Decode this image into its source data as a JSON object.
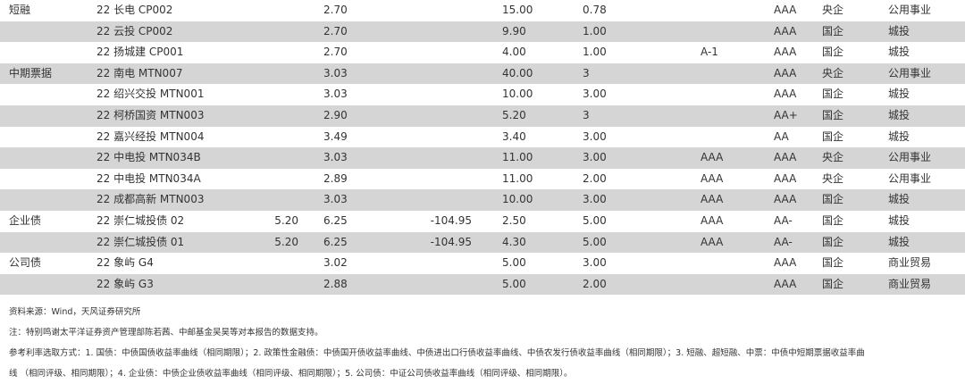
{
  "rows": [
    {
      "cat": "短融",
      "name": "22 长电 CP002",
      "c2": "",
      "c3": "2.70",
      "c4": "",
      "c5": "15.00",
      "c6": "0.78",
      "c7": "",
      "c8": "",
      "c9": "AAA",
      "c10": "央企",
      "c11": "公用事业",
      "shade": false
    },
    {
      "cat": "",
      "name": "22 云投 CP002",
      "c2": "",
      "c3": "2.70",
      "c4": "",
      "c5": "9.90",
      "c6": "1.00",
      "c7": "",
      "c8": "",
      "c9": "AAA",
      "c10": "国企",
      "c11": "城投",
      "shade": true
    },
    {
      "cat": "",
      "name": "22 扬城建 CP001",
      "c2": "",
      "c3": "2.70",
      "c4": "",
      "c5": "4.00",
      "c6": "1.00",
      "c7": "A-1",
      "c8": "",
      "c9": "AAA",
      "c10": "国企",
      "c11": "城投",
      "shade": false
    },
    {
      "cat": "中期票据",
      "name": "22 南电 MTN007",
      "c2": "",
      "c3": "3.03",
      "c4": "",
      "c5": "40.00",
      "c6": "3",
      "c7": "",
      "c8": "",
      "c9": "AAA",
      "c10": "央企",
      "c11": "公用事业",
      "shade": true
    },
    {
      "cat": "",
      "name": "22 绍兴交投 MTN001",
      "c2": "",
      "c3": "3.03",
      "c4": "",
      "c5": "10.00",
      "c6": "3.00",
      "c7": "",
      "c8": "",
      "c9": "AAA",
      "c10": "国企",
      "c11": "城投",
      "shade": false
    },
    {
      "cat": "",
      "name": "22 柯桥国资 MTN003",
      "c2": "",
      "c3": "2.90",
      "c4": "",
      "c5": "5.20",
      "c6": "3",
      "c7": "",
      "c8": "",
      "c9": "AA+",
      "c10": "国企",
      "c11": "城投",
      "shade": true
    },
    {
      "cat": "",
      "name": "22 嘉兴经投 MTN004",
      "c2": "",
      "c3": "3.49",
      "c4": "",
      "c5": "3.40",
      "c6": "3.00",
      "c7": "",
      "c8": "",
      "c9": "AA",
      "c10": "国企",
      "c11": "城投",
      "shade": false
    },
    {
      "cat": "",
      "name": "22 中电投 MTN034B",
      "c2": "",
      "c3": "3.03",
      "c4": "",
      "c5": "11.00",
      "c6": "3.00",
      "c7": "AAA",
      "c8": "",
      "c9": "AAA",
      "c10": "央企",
      "c11": "公用事业",
      "shade": true
    },
    {
      "cat": "",
      "name": "22 中电投 MTN034A",
      "c2": "",
      "c3": "2.89",
      "c4": "",
      "c5": "11.00",
      "c6": "2.00",
      "c7": "AAA",
      "c8": "",
      "c9": "AAA",
      "c10": "央企",
      "c11": "公用事业",
      "shade": false
    },
    {
      "cat": "",
      "name": "22 成都高新 MTN003",
      "c2": "",
      "c3": "3.03",
      "c4": "",
      "c5": "10.00",
      "c6": "3.00",
      "c7": "AAA",
      "c8": "",
      "c9": "AAA",
      "c10": "国企",
      "c11": "城投",
      "shade": true
    },
    {
      "cat": "企业债",
      "name": "22 崇仁城投债 02",
      "c2": "5.20",
      "c3": "6.25",
      "c4": "-104.95",
      "c5": "2.50",
      "c6": "5.00",
      "c7": "AAA",
      "c8": "",
      "c9": "AA-",
      "c10": "国企",
      "c11": "城投",
      "shade": false
    },
    {
      "cat": "",
      "name": "22 崇仁城投债 01",
      "c2": "5.20",
      "c3": "6.25",
      "c4": "-104.95",
      "c5": "4.30",
      "c6": "5.00",
      "c7": "AAA",
      "c8": "",
      "c9": "AA-",
      "c10": "国企",
      "c11": "城投",
      "shade": true
    },
    {
      "cat": "公司债",
      "name": "22 象屿 G4",
      "c2": "",
      "c3": "3.02",
      "c4": "",
      "c5": "5.00",
      "c6": "3.00",
      "c7": "",
      "c8": "",
      "c9": "AAA",
      "c10": "国企",
      "c11": "商业贸易",
      "shade": false
    },
    {
      "cat": "",
      "name": "22 象屿 G3",
      "c2": "",
      "c3": "2.88",
      "c4": "",
      "c5": "5.00",
      "c6": "2.00",
      "c7": "",
      "c8": "",
      "c9": "AAA",
      "c10": "国企",
      "c11": "商业贸易",
      "shade": true
    }
  ],
  "notes": {
    "source": "资料来源：Wind，天风证券研究所",
    "thanks": "注：特别鸣谢太平洋证券资产管理部陈若茜、中邮基金吴昊等对本报告的数据支持。",
    "method": "参考利率选取方式：1. 国债：中债国债收益率曲线（相同期限）；2. 政策性金融债：中债国开债收益率曲线、中债进出口行债收益率曲线、中债农发行债收益率曲线（相同期限）；3. 短融、超短融、中票：中债中短期票据收益率曲线（相同评级、相同期限）；4. 企业债：中债企业债收益率曲线（相同评级、相同期限）；5. 公司债：中证公司债收益率曲线（相同评级、相同期限）。",
    "method_line1": "参考利率选取方式：1. 国债：中债国债收益率曲线（相同期限）；2. 政策性金融债：中债国开债收益率曲线、中债进出口行债收益率曲线、中债农发行债收益率曲线（相同期限）；3. 短融、超短融、中票：中债中短期票据收益率曲",
    "method_line2": "线 （相同评级、相同期限）；4. 企业债：中债企业债收益率曲线（相同评级、相同期限）；5. 公司债：中证公司债收益率曲线（相同评级、相同期限）。"
  }
}
